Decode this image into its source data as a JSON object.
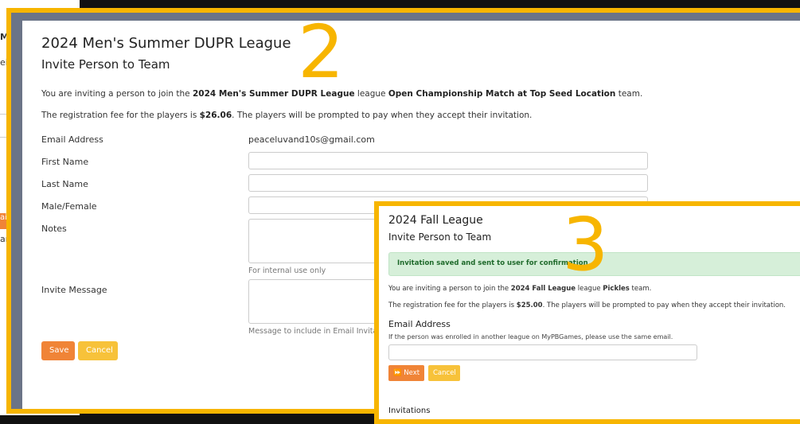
{
  "background_panel": {
    "fragments": [
      "Ma",
      "ei",
      "ail",
      "am"
    ]
  },
  "frame2": {
    "number": "2",
    "league_title": "2024 Men's Summer DUPR League",
    "subtitle": "Invite Person to Team",
    "invite_text_prefix": "You are inviting a person to join the ",
    "invite_league": "2024 Men's Summer DUPR League",
    "invite_text_mid": " league ",
    "invite_team": "Open Championship Match at Top Seed Location",
    "invite_text_suffix": " team.",
    "fee_text_prefix": "The registration fee for the players is ",
    "fee_amount": "$26.06",
    "fee_text_suffix": ". The players will be prompted to pay when they accept their invitation.",
    "fields": {
      "email_label": "Email Address",
      "email_value": "peaceluvand10s@gmail.com",
      "first_name_label": "First Name",
      "last_name_label": "Last Name",
      "gender_label": "Male/Female",
      "notes_label": "Notes",
      "notes_help": "For internal use only",
      "invite_message_label": "Invite Message",
      "invite_message_help": "Message to include in Email Invitation"
    },
    "buttons": {
      "save": "Save",
      "cancel": "Cancel"
    }
  },
  "frame3": {
    "number": "3",
    "league_title": "2024 Fall League",
    "subtitle": "Invite Person to Team",
    "alert": "Invitation saved and sent to user for confirmation",
    "invite_text_prefix": "You are inviting a person to join the ",
    "invite_league": "2024 Fall League",
    "invite_text_mid": " league ",
    "invite_team": "Pickles",
    "invite_text_suffix": " team.",
    "fee_text_prefix": "The registration fee for the players is ",
    "fee_amount": "$25.00",
    "fee_text_suffix": ". The players will be prompted to pay when they accept their invitation.",
    "email_label": "Email Address",
    "email_help": "If the person was enrolled in another league on MyPBGames, please use the same email.",
    "buttons": {
      "next": "Next",
      "cancel": "Cancel"
    },
    "invitations_heading": "Invitations"
  },
  "colors": {
    "frame_border": "#f7b500",
    "save_button": "#f08437",
    "cancel_button": "#f7c23a",
    "success_bg": "#d6efd9"
  }
}
